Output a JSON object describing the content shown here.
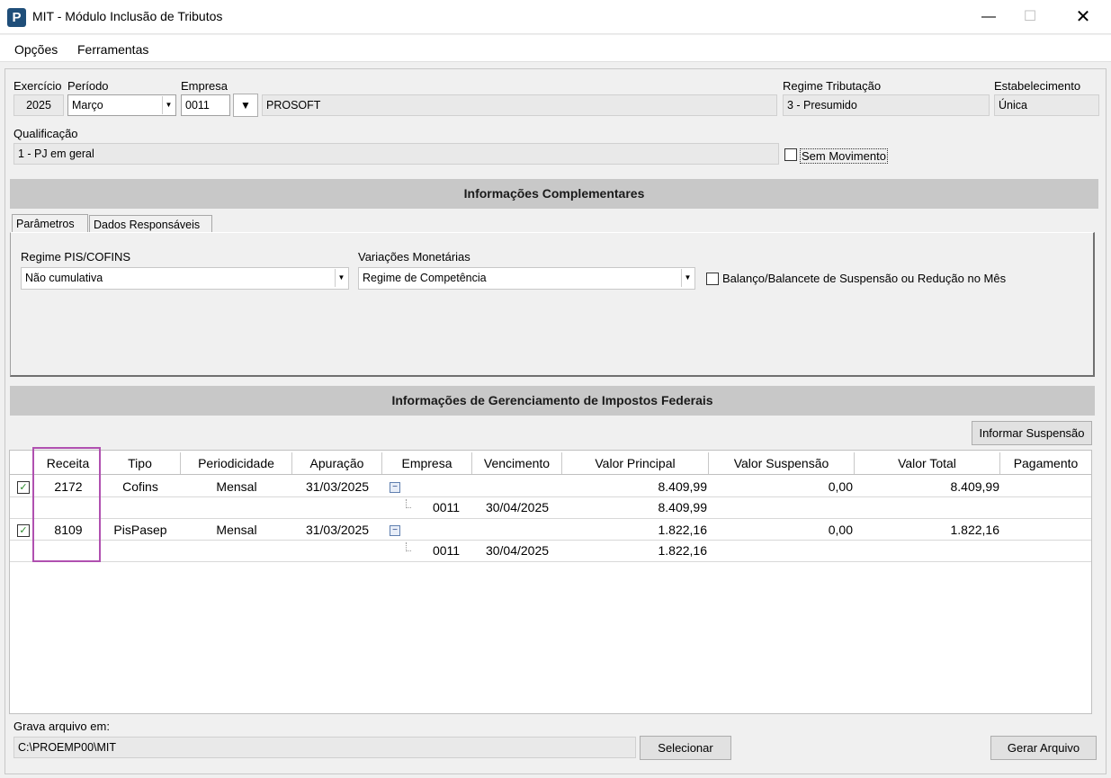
{
  "window": {
    "title": "MIT - Módulo Inclusão de Tributos",
    "app_icon_letter": "P"
  },
  "menu": [
    "Opções",
    "Ferramentas"
  ],
  "header": {
    "exercicio_label": "Exercício",
    "exercicio_value": "2025",
    "periodo_label": "Período",
    "periodo_value": "Março",
    "empresa_label": "Empresa",
    "empresa_code": "0011",
    "empresa_name": "PROSOFT",
    "regime_label": "Regime Tributação",
    "regime_value": "3 - Presumido",
    "estabelecimento_label": "Estabelecimento",
    "estabelecimento_value": "Única",
    "qualificacao_label": "Qualificação",
    "qualificacao_value": "1 - PJ em geral",
    "sem_movimento_label": "Sem Movimento"
  },
  "complementares": {
    "title": "Informações Complementares",
    "tabs": [
      "Parâmetros",
      "Dados Responsáveis"
    ],
    "regime_pis_label": "Regime PIS/COFINS",
    "regime_pis_value": "Não cumulativa",
    "variacoes_label": "Variações Monetárias",
    "variacoes_value": "Regime de Competência",
    "balanco_label": "Balanço/Balancete de Suspensão ou Redução no Mês"
  },
  "gerenciamento": {
    "title": "Informações de Gerenciamento de Impostos Federais",
    "informar_suspensao": "Informar Suspensão",
    "columns": [
      "Receita",
      "Tipo",
      "Periodicidade",
      "Apuração",
      "Empresa",
      "Vencimento",
      "Valor Principal",
      "Valor Suspensão",
      "Valor Total",
      "Pagamento"
    ],
    "rows": [
      {
        "receita": "2172",
        "tipo": "Cofins",
        "periodicidade": "Mensal",
        "apuracao": "31/03/2025",
        "valor_principal": "8.409,99",
        "valor_suspensao": "0,00",
        "valor_total": "8.409,99",
        "sub": {
          "empresa": "0011",
          "vencimento": "30/04/2025",
          "valor_principal": "8.409,99"
        }
      },
      {
        "receita": "8109",
        "tipo": "PisPasep",
        "periodicidade": "Mensal",
        "apuracao": "31/03/2025",
        "valor_principal": "1.822,16",
        "valor_suspensao": "0,00",
        "valor_total": "1.822,16",
        "sub": {
          "empresa": "0011",
          "vencimento": "30/04/2025",
          "valor_principal": "1.822,16"
        }
      }
    ]
  },
  "footer": {
    "grava_label": "Grava arquivo em:",
    "path_value": "C:\\PROEMP00\\MIT",
    "selecionar": "Selecionar",
    "gerar": "Gerar Arquivo"
  },
  "colors": {
    "section_bar": "#c8c8c8",
    "highlight": "#b050b0",
    "check": "#2a8a2a"
  }
}
